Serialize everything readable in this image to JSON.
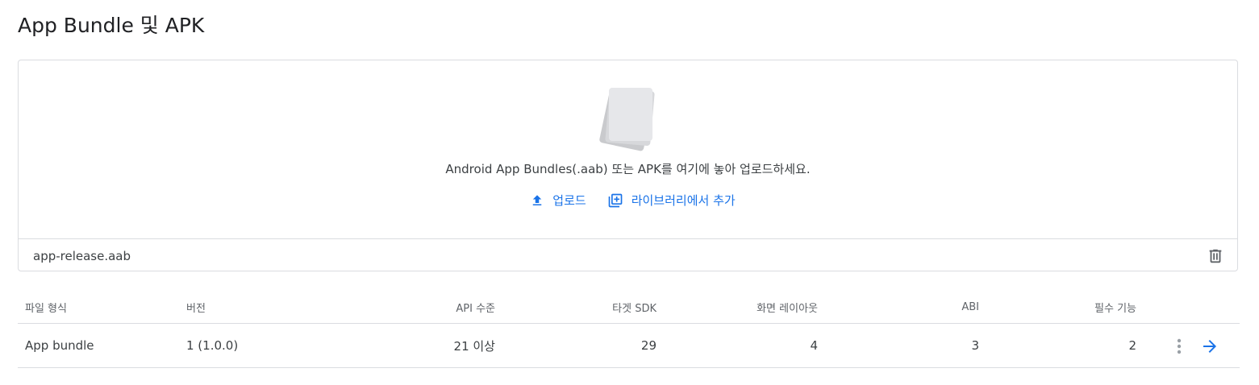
{
  "page": {
    "title": "App Bundle 및 APK"
  },
  "upload": {
    "hint": "Android App Bundles(.aab) 또는 APK를 여기에 놓아 업로드하세요.",
    "upload_label": "업로드",
    "library_label": "라이브러리에서 추가",
    "accent_color": "#1a73e8",
    "file_name": "app-release.aab"
  },
  "table": {
    "headers": {
      "file_type": "파일 형식",
      "version": "버전",
      "api_level": "API 수준",
      "target_sdk": "타겟 SDK",
      "screen_layouts": "화면 레이아웃",
      "abi": "ABI",
      "required_features": "필수 기능"
    },
    "rows": [
      {
        "file_type": "App bundle",
        "version": "1 (1.0.0)",
        "api_level": "21 이상",
        "target_sdk": "29",
        "screen_layouts": "4",
        "abi": "3",
        "required_features": "2"
      }
    ]
  },
  "icons": [
    "file-stack-icon",
    "upload-icon",
    "library-add-icon",
    "delete-icon",
    "more-vert-icon",
    "arrow-forward-icon"
  ]
}
